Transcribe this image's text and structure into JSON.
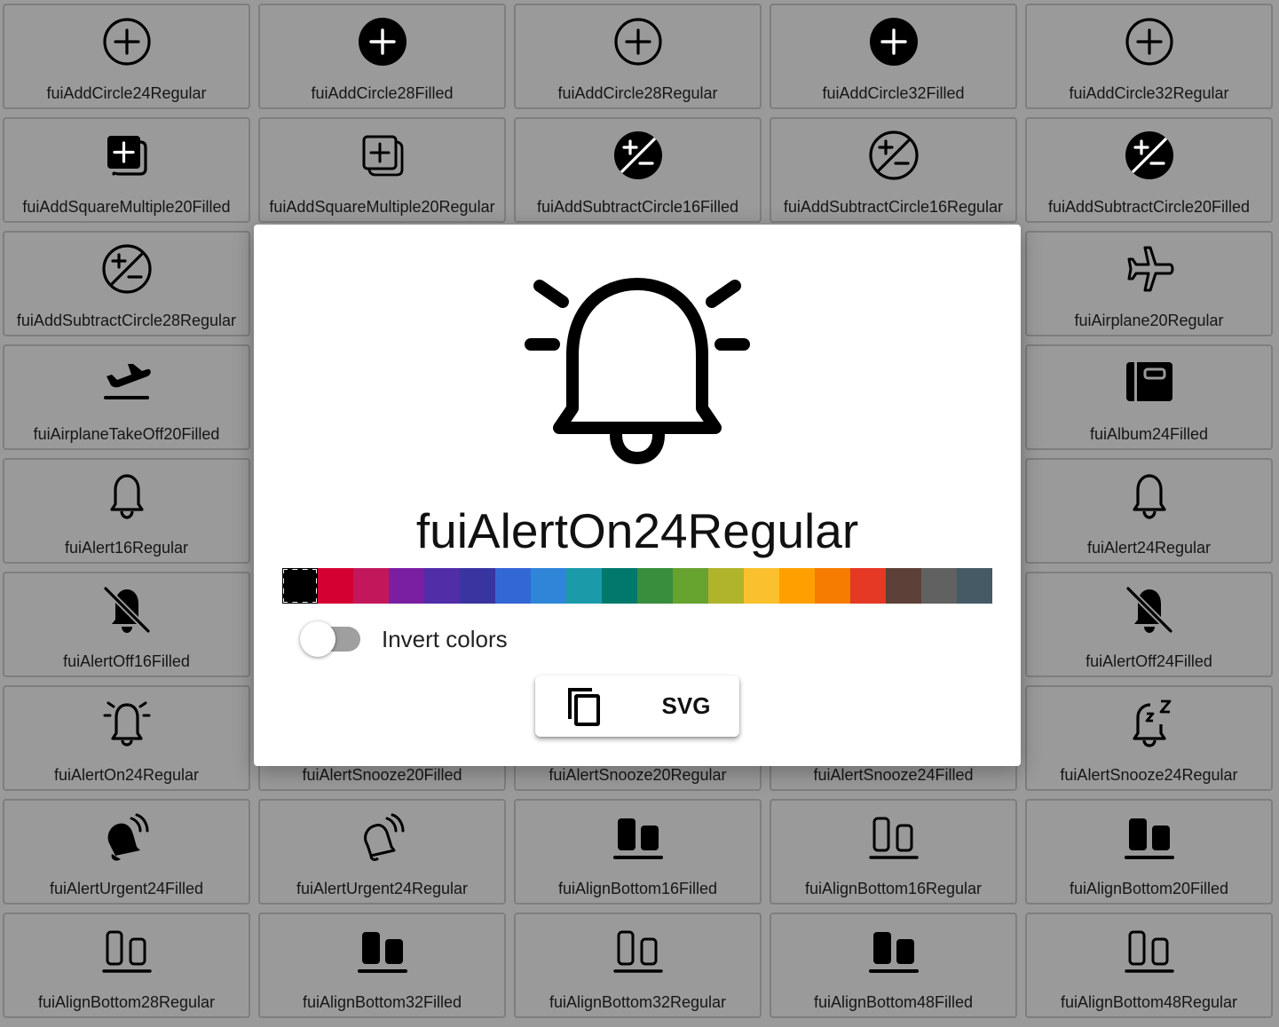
{
  "tiles": [
    {
      "name": "fuiAddCircle24Regular",
      "icon": "add-circle-regular-icon"
    },
    {
      "name": "fuiAddCircle28Filled",
      "icon": "add-circle-filled-icon"
    },
    {
      "name": "fuiAddCircle28Regular",
      "icon": "add-circle-regular-icon"
    },
    {
      "name": "fuiAddCircle32Filled",
      "icon": "add-circle-filled-icon"
    },
    {
      "name": "fuiAddCircle32Regular",
      "icon": "add-circle-regular-icon"
    },
    {
      "name": "fuiAddSquareMultiple20Filled",
      "icon": "add-square-multiple-filled-icon"
    },
    {
      "name": "fuiAddSquareMultiple20Regular",
      "icon": "add-square-multiple-regular-icon"
    },
    {
      "name": "fuiAddSubtractCircle16Filled",
      "icon": "add-subtract-circle-filled-icon"
    },
    {
      "name": "fuiAddSubtractCircle16Regular",
      "icon": "add-subtract-circle-regular-icon"
    },
    {
      "name": "fuiAddSubtractCircle20Filled",
      "icon": "add-subtract-circle-filled-icon"
    },
    {
      "name": "fuiAddSubtractCircle28Regular",
      "icon": "add-subtract-circle-regular-icon"
    },
    {
      "name": "",
      "icon": "hidden"
    },
    {
      "name": "",
      "icon": "hidden"
    },
    {
      "name": "",
      "icon": "hidden"
    },
    {
      "name": "fuiAirplane20Regular",
      "icon": "airplane-icon"
    },
    {
      "name": "fuiAirplaneTakeOff20Filled",
      "icon": "airplane-takeoff-icon"
    },
    {
      "name": "",
      "icon": "hidden"
    },
    {
      "name": "",
      "icon": "hidden"
    },
    {
      "name": "",
      "icon": "hidden"
    },
    {
      "name": "fuiAlbum24Filled",
      "icon": "album-icon"
    },
    {
      "name": "fuiAlert16Regular",
      "icon": "bell-icon"
    },
    {
      "name": "",
      "icon": "hidden"
    },
    {
      "name": "",
      "icon": "hidden"
    },
    {
      "name": "",
      "icon": "hidden"
    },
    {
      "name": "fuiAlert24Regular",
      "icon": "bell-icon"
    },
    {
      "name": "fuiAlertOff16Filled",
      "icon": "bell-off-icon"
    },
    {
      "name": "",
      "icon": "hidden"
    },
    {
      "name": "",
      "icon": "hidden"
    },
    {
      "name": "",
      "icon": "hidden"
    },
    {
      "name": "fuiAlertOff24Filled",
      "icon": "bell-off-icon"
    },
    {
      "name": "fuiAlertOn24Regular",
      "icon": "bell-ringing-icon"
    },
    {
      "name": "fuiAlertSnooze20Filled",
      "icon": "hidden"
    },
    {
      "name": "fuiAlertSnooze20Regular",
      "icon": "hidden"
    },
    {
      "name": "fuiAlertSnooze24Filled",
      "icon": "hidden"
    },
    {
      "name": "fuiAlertSnooze24Regular",
      "icon": "bell-snooze-icon"
    },
    {
      "name": "fuiAlertUrgent24Filled",
      "icon": "alert-urgent-filled-icon"
    },
    {
      "name": "fuiAlertUrgent24Regular",
      "icon": "alert-urgent-regular-icon"
    },
    {
      "name": "fuiAlignBottom16Filled",
      "icon": "align-bottom-filled-icon"
    },
    {
      "name": "fuiAlignBottom16Regular",
      "icon": "align-bottom-regular-icon"
    },
    {
      "name": "fuiAlignBottom20Filled",
      "icon": "align-bottom-filled-icon"
    },
    {
      "name": "fuiAlignBottom28Regular",
      "icon": "align-bottom-regular-icon"
    },
    {
      "name": "fuiAlignBottom32Filled",
      "icon": "align-bottom-filled-icon"
    },
    {
      "name": "fuiAlignBottom32Regular",
      "icon": "align-bottom-regular-icon"
    },
    {
      "name": "fuiAlignBottom48Filled",
      "icon": "align-bottom-filled-icon"
    },
    {
      "name": "fuiAlignBottom48Regular",
      "icon": "align-bottom-regular-icon"
    }
  ],
  "dialog": {
    "title": "fuiAlertOn24Regular",
    "icon": "bell-ringing-icon",
    "invert_label": "Invert colors",
    "invert_on": false,
    "copy_icon": "copy-icon",
    "svg_label": "SVG",
    "palette": [
      "#000000",
      "#d50032",
      "#c2185b",
      "#7b1fa2",
      "#512da8",
      "#3a34a0",
      "#3367d6",
      "#2f85d8",
      "#1b9aaa",
      "#00796b",
      "#388e3c",
      "#67a32f",
      "#afb42b",
      "#fbc02d",
      "#ffa000",
      "#f57c00",
      "#e53925",
      "#5d4037",
      "#616161",
      "#455a64"
    ],
    "selected_color": "#000000"
  }
}
